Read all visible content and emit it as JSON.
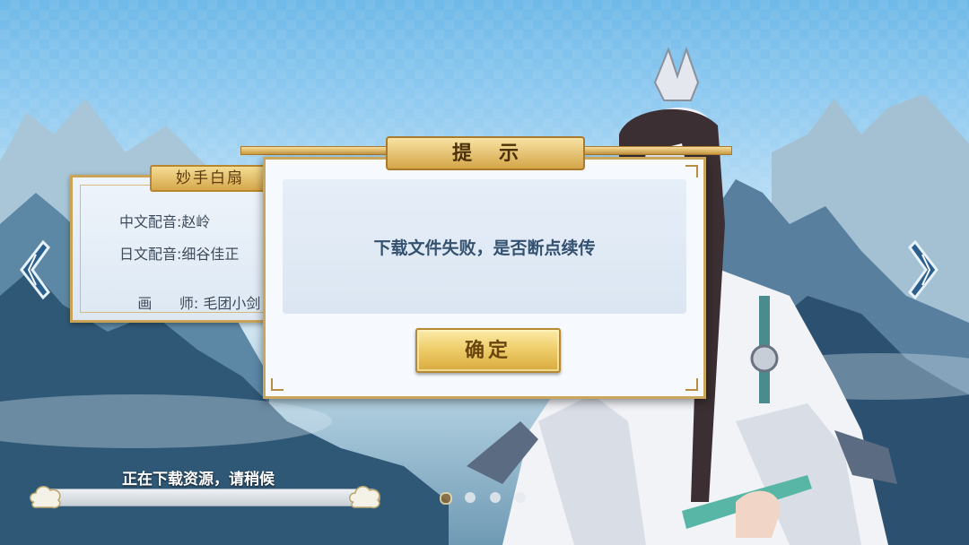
{
  "credits": {
    "title": "妙手白扇",
    "rows": [
      {
        "label": "中文配音: ",
        "value": "赵岭"
      },
      {
        "label": "日文配音: ",
        "value": "细谷佳正"
      },
      {
        "label": "画      师: ",
        "value": "毛团小剑"
      }
    ]
  },
  "dialog": {
    "title": "提示",
    "message": "下载文件失败，是否断点续传",
    "confirm_label": "确定"
  },
  "loading": {
    "status_text": "正在下载资源，请稍候",
    "progress": 0
  },
  "pager": {
    "count": 4,
    "active_index": 0
  },
  "icons": {
    "left": "chevron-left-icon",
    "right": "chevron-right-icon"
  },
  "colors": {
    "gold": "#caa65c",
    "accent_text": "#34516f"
  }
}
